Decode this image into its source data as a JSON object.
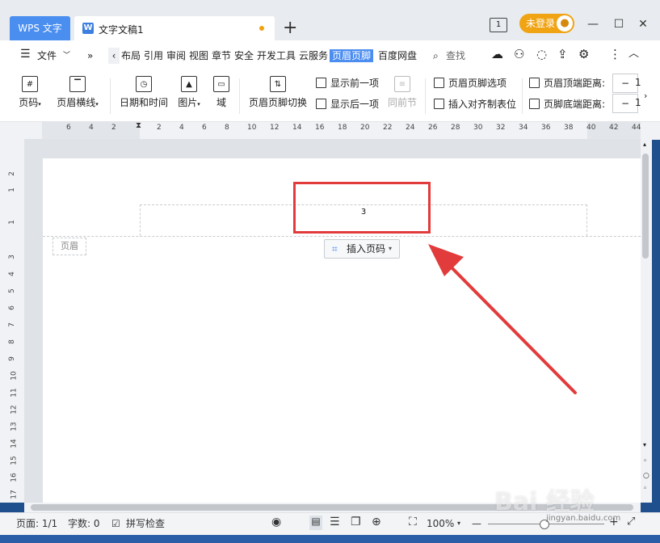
{
  "titlebar": {
    "app_tab": "WPS 文字",
    "doc_tab": "文字文稿1",
    "new_tab": "+",
    "tab_count": "1",
    "login": "未登录"
  },
  "menu": {
    "file": "文件",
    "items": [
      "布局",
      "引用",
      "审阅",
      "视图",
      "章节",
      "安全",
      "开发工具",
      "云服务"
    ],
    "active": "页眉页脚",
    "after_active": "百度网盘",
    "search": "查找"
  },
  "ribbon": {
    "page_number": "页码",
    "header_line": "页眉横线",
    "date_time": "日期和时间",
    "picture": "图片",
    "field": "域",
    "switch": "页眉页脚切换",
    "show_prev": "显示前一项",
    "show_next": "显示后一项",
    "prev_section": "同前节",
    "hf_options": "页眉页脚选项",
    "insert_align_tab": "插入对齐制表位",
    "header_top_dist": "页眉顶端距离:",
    "footer_bottom_dist": "页脚底端距离:",
    "stepper_top": "1",
    "stepper_bottom": "1"
  },
  "ruler": {
    "h_ticks": [
      "6",
      "4",
      "2",
      "2",
      "4",
      "6",
      "8",
      "10",
      "12",
      "14",
      "16",
      "18",
      "20",
      "22",
      "24",
      "26",
      "28",
      "30",
      "32",
      "34",
      "36",
      "38",
      "40",
      "42",
      "44"
    ],
    "v_ticks": [
      "2",
      "1",
      "1",
      "3",
      "4",
      "5",
      "6",
      "7",
      "8",
      "9",
      "10",
      "11",
      "12",
      "13",
      "14",
      "15",
      "16",
      "17"
    ]
  },
  "document": {
    "page_number_value": "3",
    "header_label": "页眉",
    "insert_page_number": "插入页码"
  },
  "status": {
    "page": "页面: 1/1",
    "words": "字数: 0",
    "spellcheck": "拼写检查",
    "zoom": "100%"
  },
  "watermark": {
    "text": "Bai 经验",
    "sub": "jingyan.baidu.com"
  }
}
